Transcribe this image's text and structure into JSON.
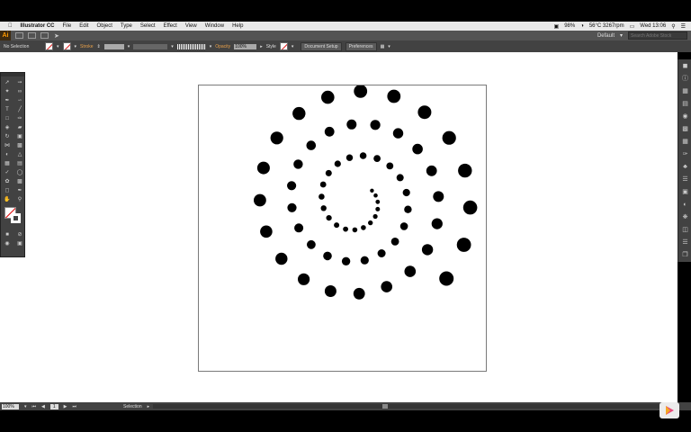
{
  "menubar": {
    "app_name": "Illustrator CC",
    "items": [
      "File",
      "Edit",
      "Object",
      "Type",
      "Select",
      "Effect",
      "View",
      "Window",
      "Help"
    ],
    "status": {
      "battery": "98%",
      "weather": "56°C 3267rpm",
      "clock": "Wed 13:06"
    }
  },
  "appbar": {
    "logo": "Ai",
    "workspace": "Default",
    "search_placeholder": "Search Adobe Stock"
  },
  "control": {
    "selection": "No Selection",
    "stroke_label": "Stroke",
    "opacity_label": "Opacity",
    "opacity_value": "100%",
    "style_label": "Style",
    "document_setup": "Document Setup",
    "preferences": "Preferences"
  },
  "statusbar": {
    "zoom": "100%",
    "page": "1",
    "mode": "Selection"
  },
  "icons": {
    "apple": "apple-icon",
    "spotlight": "search-icon",
    "tools": [
      "selection-tool",
      "direct-selection-tool",
      "magic-wand-tool",
      "lasso-tool",
      "pen-tool",
      "curvature-tool",
      "type-tool",
      "line-tool",
      "rectangle-tool",
      "paintbrush-tool",
      "shaper-tool",
      "eraser-tool",
      "rotate-tool",
      "scale-tool",
      "width-tool",
      "free-transform-tool",
      "shape-builder-tool",
      "perspective-tool",
      "mesh-tool",
      "gradient-tool",
      "eyedropper-tool",
      "blend-tool",
      "symbol-sprayer-tool",
      "column-graph-tool",
      "artboard-tool",
      "slice-tool",
      "hand-tool",
      "zoom-tool"
    ]
  },
  "colors": {
    "menubar": "#e9e9e9",
    "panel": "#424242",
    "canvas": "#ffffff",
    "dots": "#000000",
    "accent": "#ff9a00"
  }
}
